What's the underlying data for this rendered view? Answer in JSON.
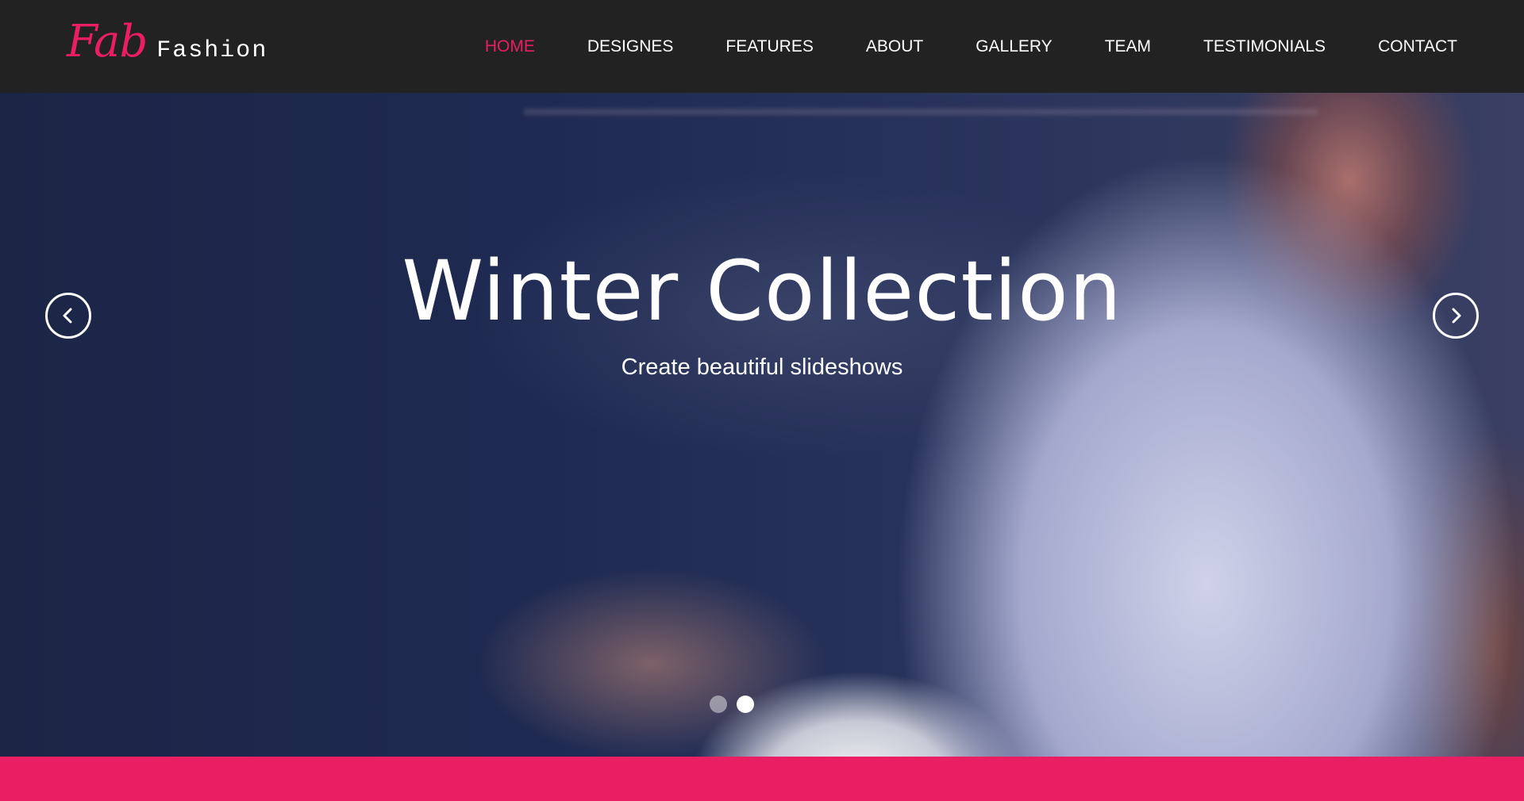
{
  "brand": {
    "script": "Fab",
    "word": "Fashion"
  },
  "nav": {
    "items": [
      {
        "label": "HOME",
        "active": true
      },
      {
        "label": "DESIGNES",
        "active": false
      },
      {
        "label": "FEATURES",
        "active": false
      },
      {
        "label": "ABOUT",
        "active": false
      },
      {
        "label": "GALLERY",
        "active": false
      },
      {
        "label": "TEAM",
        "active": false
      },
      {
        "label": "TESTIMONIALS",
        "active": false
      },
      {
        "label": "CONTACT",
        "active": false
      }
    ]
  },
  "hero": {
    "title": "Winter Collection",
    "subtitle": "Create beautiful slideshows",
    "prev_icon": "chevron-left-icon",
    "next_icon": "chevron-right-icon",
    "slides_total": 2,
    "active_slide": 2
  },
  "colors": {
    "accent": "#e91e63",
    "header_bg": "#222222",
    "text": "#ffffff"
  }
}
